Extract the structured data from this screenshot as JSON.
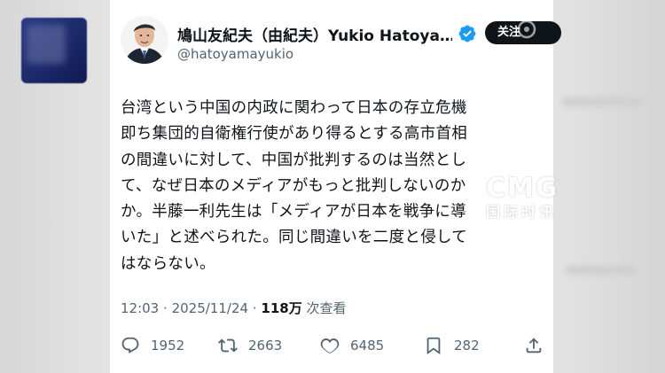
{
  "author": {
    "name": "鳩山友紀夫（由紀夫）Yukio Hatoya…",
    "handle": "@hatoyamayukio",
    "follow_label": "关注"
  },
  "tweet": {
    "lines": [
      "台湾という中国の内政に関わって日本の存立危機",
      "即ち集団的自衛権行使があり得るとする高市首相",
      "の間違いに対して、中国が批判するのは当然とし",
      "て、なぜ日本のメディアがもっと批判しないのか",
      "か。半藤一利先生は「メディアが日本を戦争に導",
      "いた」と述べられた。同じ間違いを二度と侵して",
      "はならない。"
    ],
    "time": "12:03",
    "separator": "·",
    "date": "2025/11/24",
    "views_count": "118万",
    "views_label": "次查看"
  },
  "actions": {
    "reply_count": "1952",
    "retweet_count": "2663",
    "like_count": "6485",
    "bookmark_count": "282"
  },
  "watermark": {
    "brand": "CMG",
    "subtitle": "国际时讯"
  },
  "colors": {
    "text": "#0f1419",
    "secondary": "#536471",
    "verified": "#1d9bf0",
    "follow_bg": "#0f1419"
  }
}
